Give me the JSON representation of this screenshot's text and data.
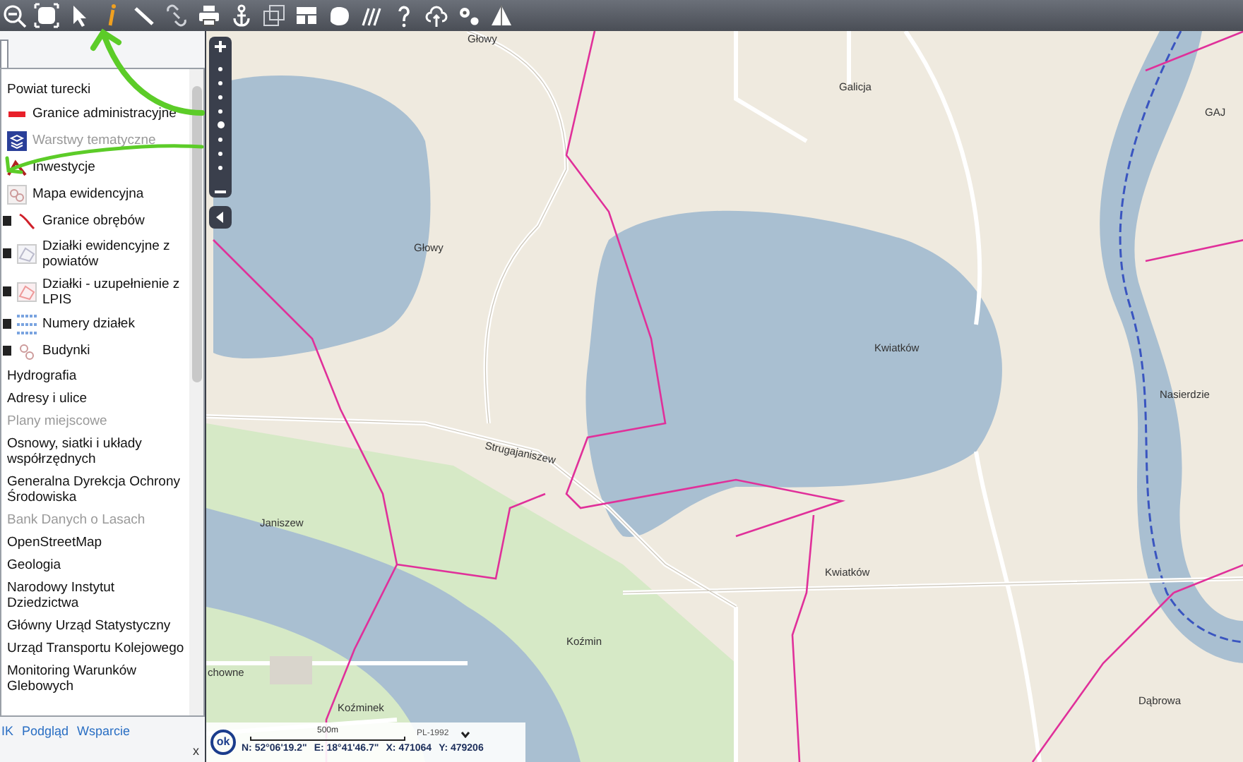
{
  "layers": [
    {
      "label": "Powiat turecki",
      "disabled": false
    },
    {
      "label": "Granice administracyjne",
      "disabled": false
    },
    {
      "label": "Warstwy tematyczne",
      "disabled": true
    },
    {
      "label": "Inwestycje",
      "disabled": false
    },
    {
      "label": "Mapa ewidencyjna",
      "disabled": false,
      "children": [
        {
          "label": "Granice obrębów",
          "checked": true
        },
        {
          "label": "Działki ewidencyjne z powiatów",
          "checked": true
        },
        {
          "label": "Działki - uzupełnienie z LPIS",
          "checked": true
        },
        {
          "label": "Numery działek",
          "checked": true
        },
        {
          "label": "Budynki",
          "checked": true
        }
      ]
    },
    {
      "label": "Hydrografia",
      "disabled": false
    },
    {
      "label": "Adresy i ulice",
      "disabled": false
    },
    {
      "label": "Plany miejscowe",
      "disabled": true
    },
    {
      "label": "Osnowy, siatki i układy współrzędnych",
      "disabled": false
    },
    {
      "label": "Generalna Dyrekcja Ochrony Środowiska",
      "disabled": false
    },
    {
      "label": "Bank Danych o Lasach",
      "disabled": true
    },
    {
      "label": "OpenStreetMap",
      "disabled": false
    },
    {
      "label": "Geologia",
      "disabled": false
    },
    {
      "label": "Narodowy Instytut Dziedzictwa",
      "disabled": false
    },
    {
      "label": "Główny Urząd Statystyczny",
      "disabled": false
    },
    {
      "label": "Urząd Transportu Kolejowego",
      "disabled": false
    },
    {
      "label": "Monitoring Warunków Glebowych",
      "disabled": false
    }
  ],
  "zoom": {
    "level": 0.43
  },
  "footer_links": [
    "IK",
    "Podgląd",
    "Wsparcie"
  ],
  "close_label": "x",
  "map": {
    "labels": [
      "Głowy",
      "Głowy",
      "Galicja",
      "GAJ",
      "Kwiatków",
      "Nasierdzie",
      "Strugajaniszew",
      "Janiszew",
      "Kwiatków",
      "Koźmin",
      "Dąbrowa",
      "chowne",
      "Koźminek"
    ]
  },
  "status": {
    "ok": "ok",
    "scale": "500m",
    "projection": "PL-1992",
    "n": "N: 52°06'19.2\"",
    "e": "E: 18°41'46.7\"",
    "x": "X: 471064",
    "y": "Y: 479206"
  }
}
